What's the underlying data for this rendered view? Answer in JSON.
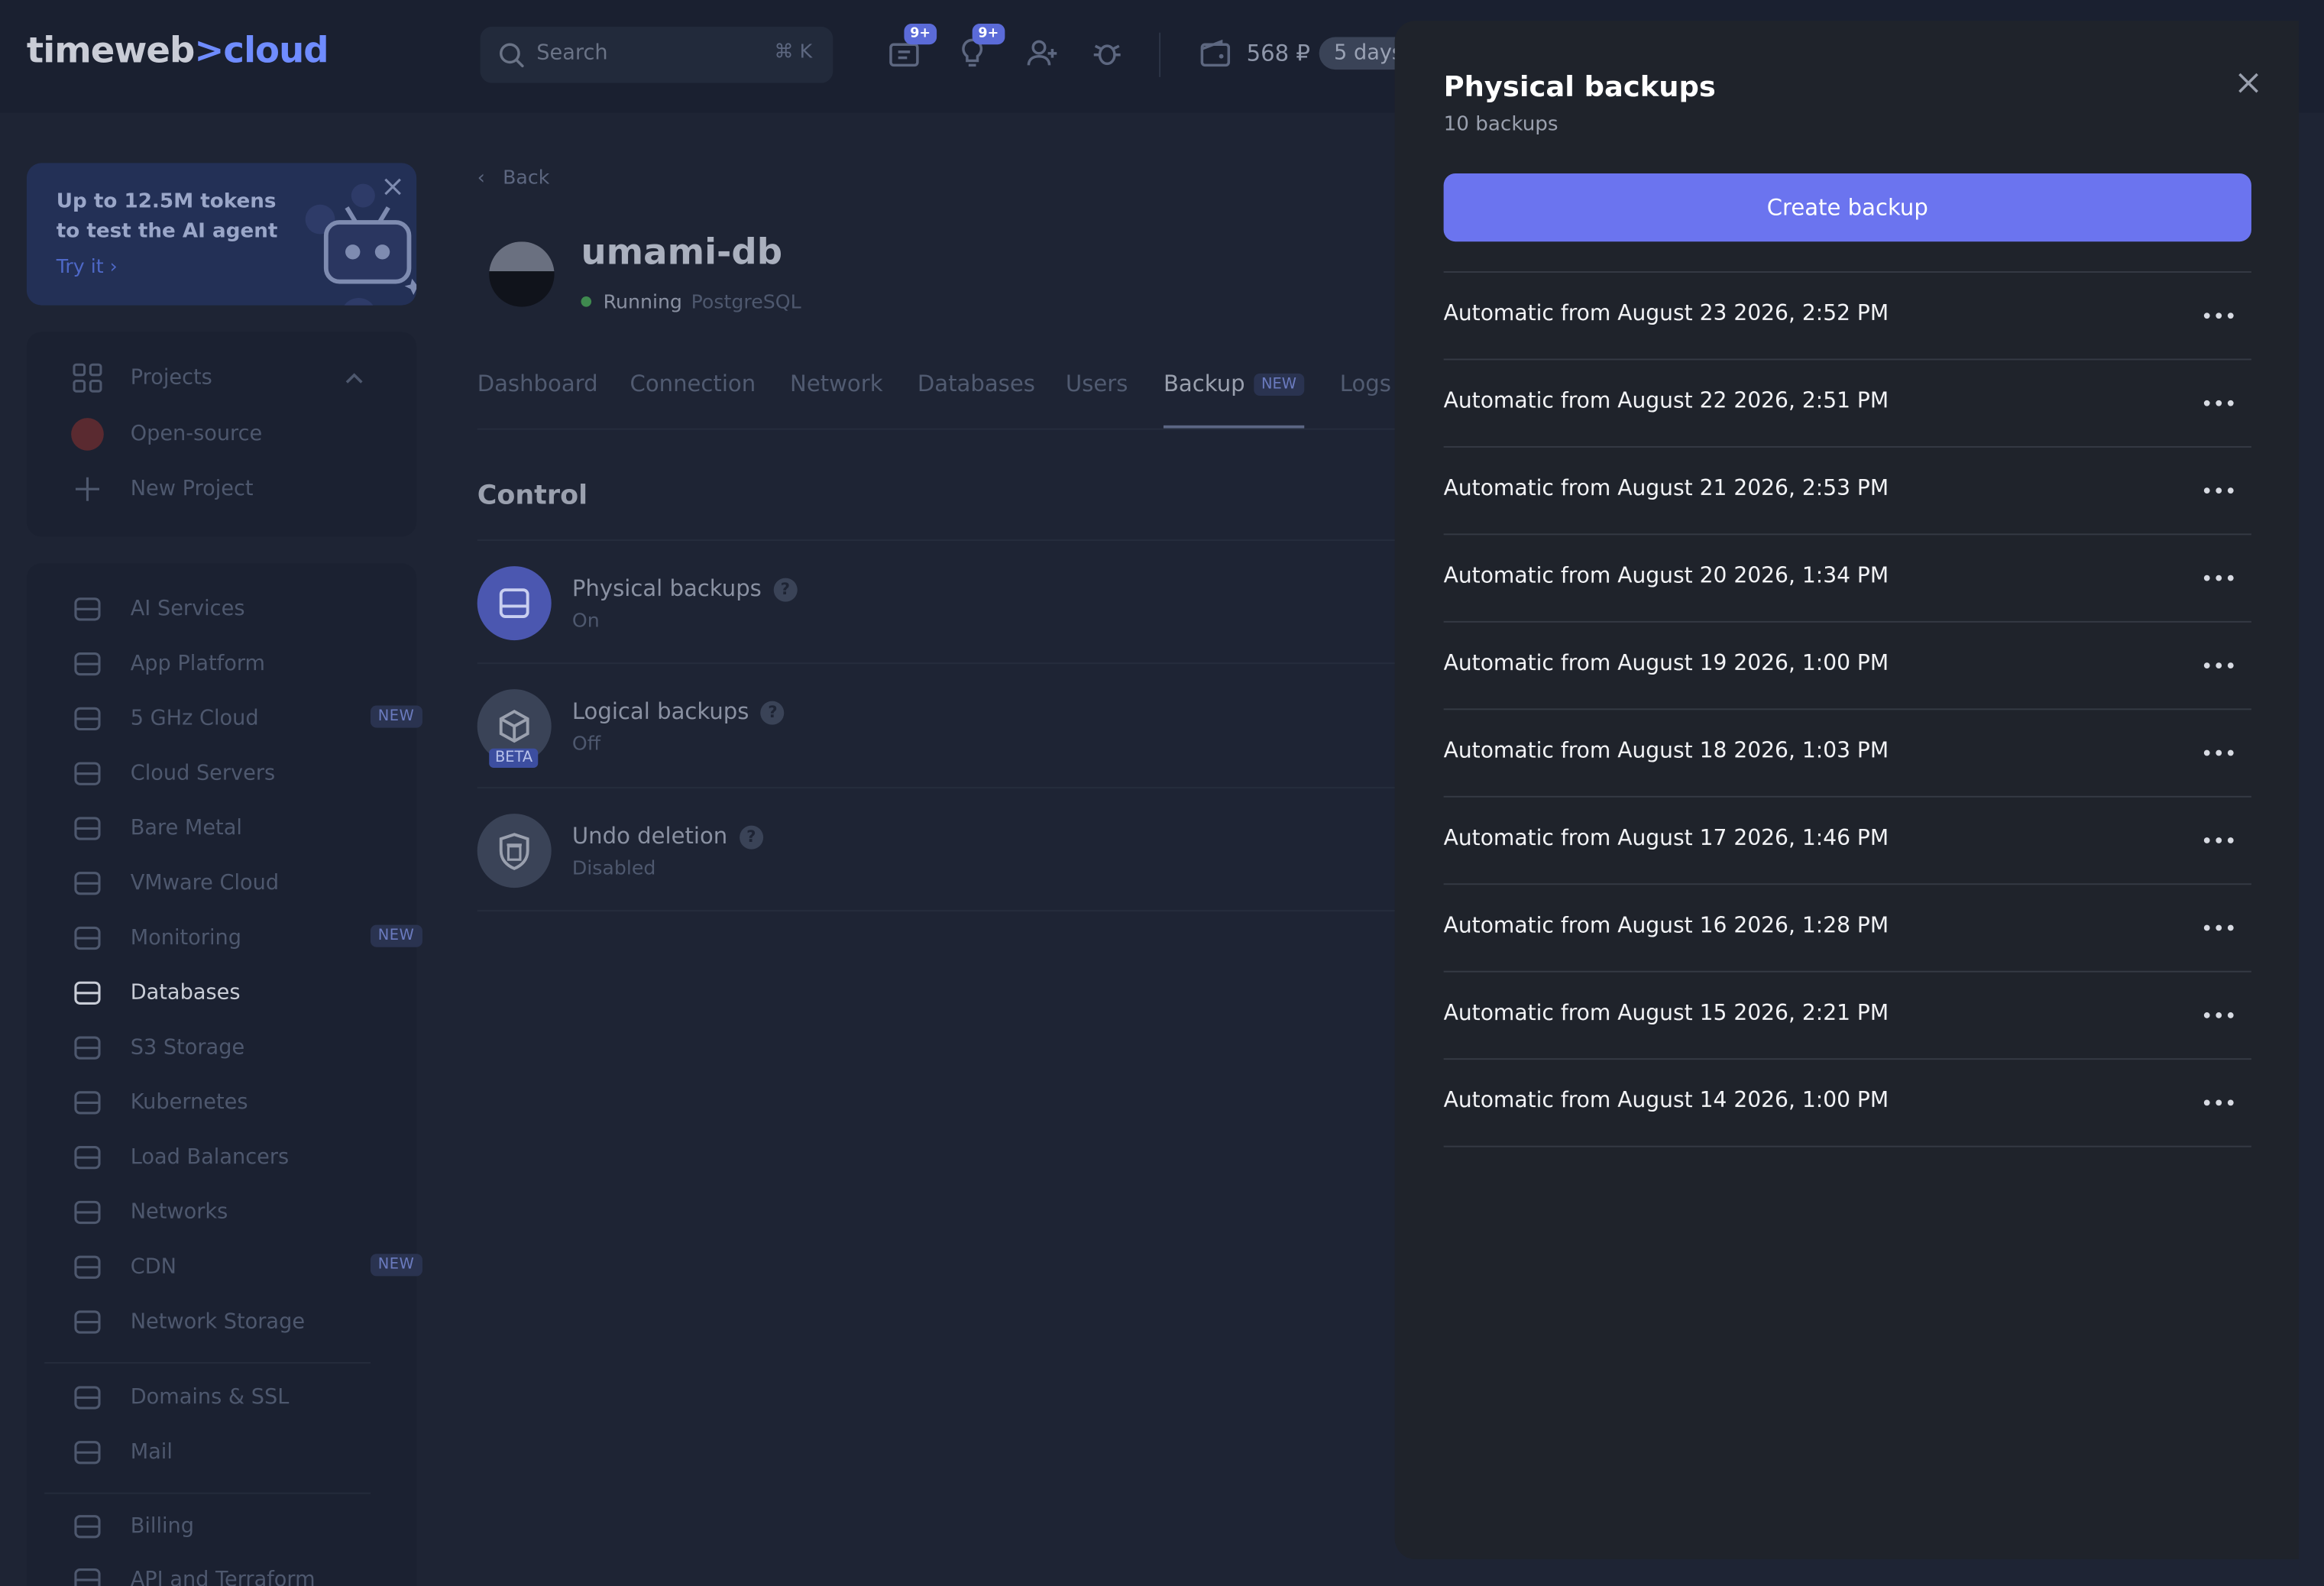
{
  "brand": {
    "part1": "timeweb",
    "sep": ">",
    "part2": "cloud"
  },
  "search": {
    "placeholder": "Search",
    "shortcut": "⌘ K"
  },
  "topbar": {
    "badge1": "9+",
    "badge2": "9+",
    "balance": "568 ₽",
    "days": "5 days"
  },
  "promo": {
    "line1": "Up to 12.5M tokens",
    "line2": "to test the AI agent",
    "link": "Try it"
  },
  "projects": {
    "header": "Projects",
    "items": [
      "Open-source",
      "New Project"
    ]
  },
  "nav": {
    "items": [
      {
        "label": "AI Services",
        "icon": "ai-icon"
      },
      {
        "label": "App Platform",
        "icon": "apps-icon"
      },
      {
        "label": "5 GHz Cloud",
        "icon": "bolt-cloud-icon",
        "tag": "NEW"
      },
      {
        "label": "Cloud Servers",
        "icon": "cloud-icon"
      },
      {
        "label": "Bare Metal",
        "icon": "server-icon"
      },
      {
        "label": "VMware Cloud",
        "icon": "vmware-icon"
      },
      {
        "label": "Monitoring",
        "icon": "monitoring-icon",
        "tag": "NEW"
      },
      {
        "label": "Databases",
        "icon": "database-icon"
      },
      {
        "label": "S3 Storage",
        "icon": "cube-icon"
      },
      {
        "label": "Kubernetes",
        "icon": "kubernetes-icon"
      },
      {
        "label": "Load Balancers",
        "icon": "arrows-icon"
      },
      {
        "label": "Networks",
        "icon": "network-icon"
      },
      {
        "label": "CDN",
        "icon": "cdn-icon",
        "tag": "NEW"
      },
      {
        "label": "Network Storage",
        "icon": "storage-icon"
      },
      {
        "label": "Domains & SSL",
        "icon": "globe-icon"
      },
      {
        "label": "Mail",
        "icon": "mail-icon"
      },
      {
        "label": "Billing",
        "icon": "card-icon"
      },
      {
        "label": "API and Terraform",
        "icon": "api-icon"
      }
    ]
  },
  "main": {
    "back": "Back",
    "db_name": "umami-db",
    "status": "Running",
    "engine": "PostgreSQL",
    "tabs": [
      "Dashboard",
      "Connection",
      "Network",
      "Databases",
      "Users",
      "Backup",
      "Logs"
    ],
    "backup_tag": "NEW",
    "section": "Control",
    "controls": [
      {
        "title": "Physical backups",
        "sub": "On"
      },
      {
        "title": "Logical backups",
        "sub": "Off",
        "badge": "BETA"
      },
      {
        "title": "Undo deletion",
        "sub": "Disabled"
      }
    ]
  },
  "panel": {
    "title": "Physical backups",
    "count": "10 backups",
    "create_label": "Create backup",
    "backups": [
      "Automatic from August 23 2026, 2:52 PM",
      "Automatic from August 22 2026, 2:51 PM",
      "Automatic from August 21 2026, 2:53 PM",
      "Automatic from August 20 2026, 1:34 PM",
      "Automatic from August 19 2026, 1:00 PM",
      "Automatic from August 18 2026, 1:03 PM",
      "Automatic from August 17 2026, 1:46 PM",
      "Automatic from August 16 2026, 1:28 PM",
      "Automatic from August 15 2026, 2:21 PM",
      "Automatic from August 14 2026, 1:00 PM"
    ]
  },
  "colors": {
    "accent": "#6b74ef",
    "panel_bg": "#1f232b",
    "page_bg": "#1e2434"
  }
}
